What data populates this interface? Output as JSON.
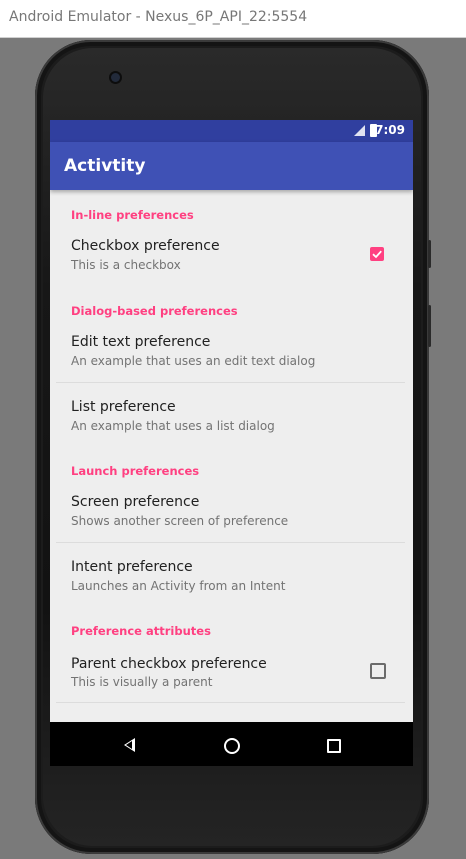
{
  "window": {
    "title": "Android Emulator - Nexus_6P_API_22:5554"
  },
  "status_bar": {
    "time": "7:09"
  },
  "app_bar": {
    "title": "Activtity"
  },
  "preferences": {
    "cat1": "In-line preferences",
    "checkbox": {
      "title": "Checkbox preference",
      "summary": "This is a checkbox",
      "checked": true
    },
    "cat2": "Dialog-based preferences",
    "edit_text": {
      "title": "Edit text preference",
      "summary": "An example that uses an edit text dialog"
    },
    "list": {
      "title": "List preference",
      "summary": "An example that uses a list dialog"
    },
    "cat3": "Launch preferences",
    "screen": {
      "title": "Screen preference",
      "summary": "Shows another screen of preference"
    },
    "intent": {
      "title": "Intent preference",
      "summary": "Launches an Activity from an Intent"
    },
    "cat4": "Preference attributes",
    "parent_checkbox": {
      "title": "Parent checkbox preference",
      "summary": "This is visually a parent",
      "checked": false
    }
  },
  "nav_bar": {
    "back_icon": "back-icon",
    "home_icon": "home-icon",
    "recents_icon": "recents-icon"
  },
  "colors": {
    "primary": "#3f51b5",
    "primary_dark": "#303f9f",
    "accent": "#ff4081"
  }
}
